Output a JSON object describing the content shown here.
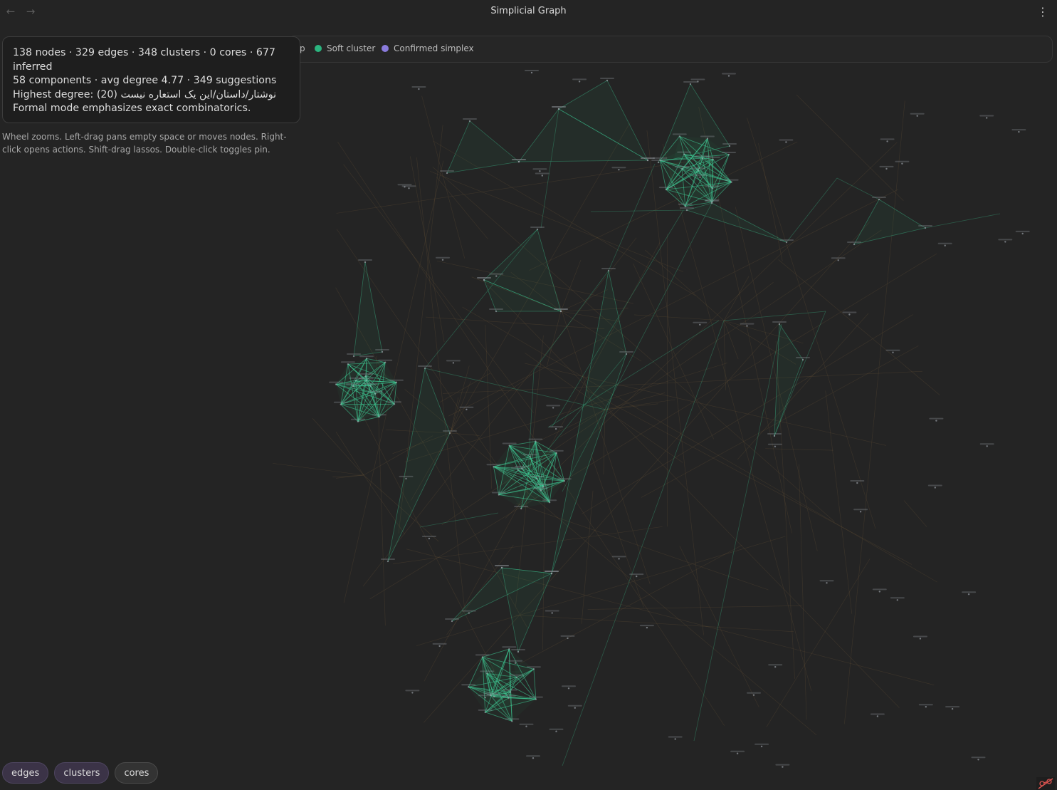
{
  "window": {
    "title": "Simplicial Graph",
    "back_icon": "arrow-left-icon",
    "forward_icon": "arrow-right-icon",
    "more_icon": "more-vertical-icon"
  },
  "legend": {
    "items": [
      {
        "label": "p",
        "color": "#9a7a4c"
      },
      {
        "label": "Soft cluster",
        "color": "#2bb57f"
      },
      {
        "label": "Confirmed simplex",
        "color": "#8a7bdc"
      }
    ]
  },
  "stats": {
    "line1": "138 nodes · 329 edges · 348 clusters · 0 cores · 677",
    "line1b": "inferred",
    "line2": "58 components · avg degree 4.77 · 349 suggestions",
    "line3": "Highest degree: نوشتار/داستان/این یک استعاره نیست (20)",
    "line4": "Formal mode emphasizes exact combinatorics."
  },
  "help": {
    "text": "Wheel zooms. Left-drag pans empty space or moves nodes. Right-click opens actions. Shift-drag lassos. Double-click toggles pin."
  },
  "toggles": [
    {
      "label": "edges",
      "active": true
    },
    {
      "label": "clusters",
      "active": true
    },
    {
      "label": "cores",
      "active": false
    }
  ],
  "colors": {
    "background": "#242424",
    "cluster_fill": "#2c9a6a",
    "cluster_edge": "#3fd39a",
    "inferred_edge": "#8a6a3e",
    "node": "#9aa0a6",
    "error_icon": "#d9534f"
  },
  "corner_icon": "graph-off-error-icon"
}
